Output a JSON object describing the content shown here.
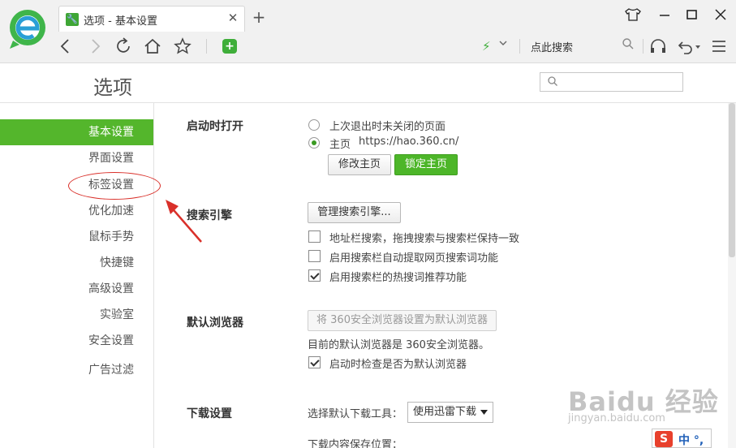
{
  "browser": {
    "tab_title": "选项 - 基本设置",
    "tab_close": "✕",
    "new_tab": "+",
    "search_placeholder": "点此搜索"
  },
  "page": {
    "title": "选项"
  },
  "sidebar": {
    "items": [
      {
        "label": "基本设置",
        "active": true
      },
      {
        "label": "界面设置"
      },
      {
        "label": "标签设置"
      },
      {
        "label": "优化加速"
      },
      {
        "label": "鼠标手势"
      },
      {
        "label": "快捷键"
      },
      {
        "label": "高级设置"
      },
      {
        "label": "实验室"
      },
      {
        "label": "安全设置"
      },
      {
        "label": "广告过滤"
      }
    ]
  },
  "startup": {
    "label": "启动时打开",
    "option_last": "上次退出时未关闭的页面",
    "option_home": "主页",
    "home_url": "https://hao.360.cn/",
    "modify_btn": "修改主页",
    "lock_btn": "锁定主页"
  },
  "search_engine": {
    "label": "搜索引擎",
    "manage_btn": "管理搜索引擎...",
    "checks": [
      {
        "label": "地址栏搜索，拖拽搜索与搜索栏保持一致",
        "checked": false
      },
      {
        "label": "启用搜索栏自动提取网页搜索词功能",
        "checked": false
      },
      {
        "label": "启用搜索栏的热搜词推荐功能",
        "checked": true
      }
    ]
  },
  "default_browser": {
    "label": "默认浏览器",
    "set_btn": "将 360安全浏览器设置为默认浏览器",
    "current_text": "目前的默认浏览器是 360安全浏览器。",
    "check_label": "启动时检查是否为默认浏览器",
    "checked": true
  },
  "download": {
    "label": "下载设置",
    "tool_label": "选择默认下载工具：",
    "tool_value": "使用迅雷下载",
    "save_label": "下载内容保存位置："
  },
  "watermark": {
    "main": "Baidu 经验",
    "url": "jingyan.baidu.com"
  },
  "ime": {
    "logo": "S",
    "text": "中 °,"
  },
  "colors": {
    "accent": "#54b62c",
    "annotation": "#d9302a"
  }
}
